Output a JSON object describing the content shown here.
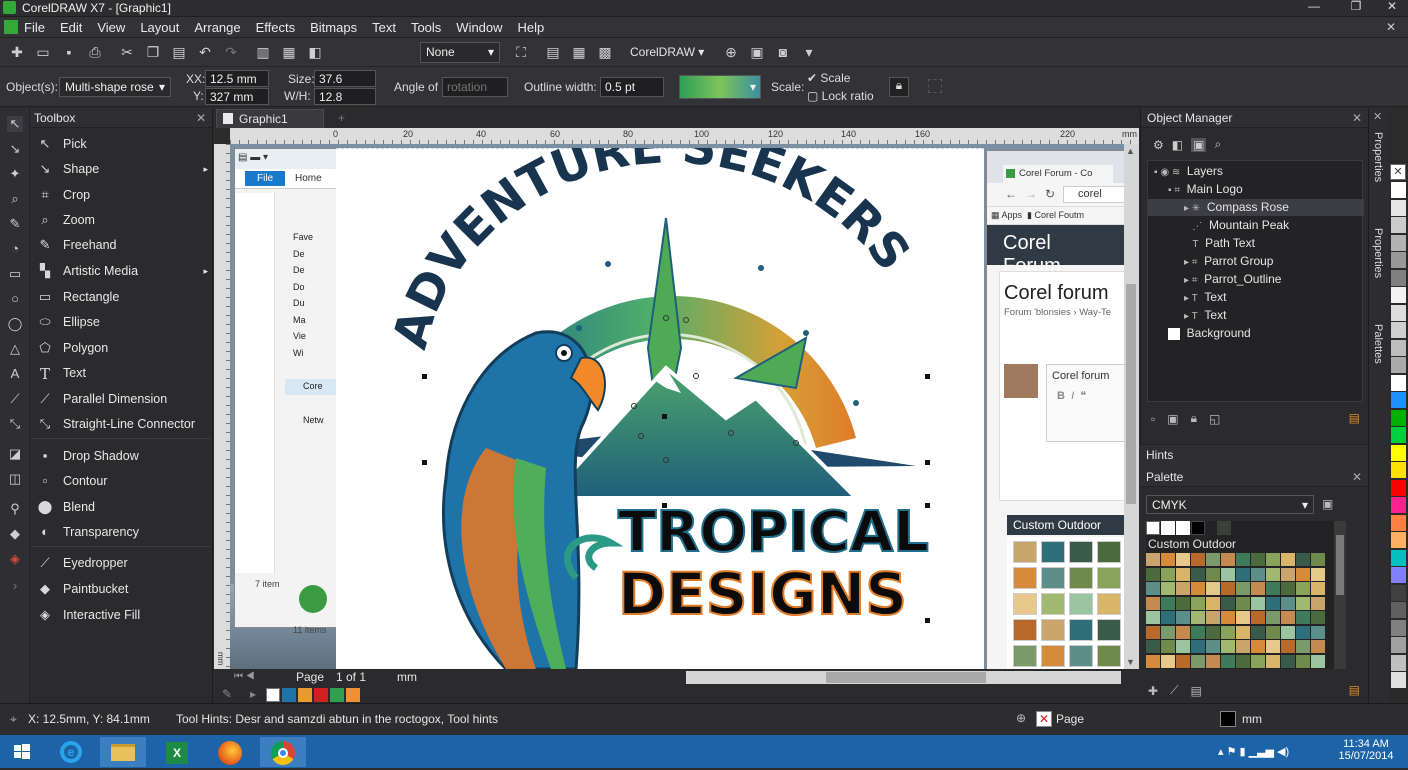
{
  "window": {
    "title": "CorelDRAW X7 - [Graphic1]"
  },
  "menu": [
    "File",
    "Edit",
    "View",
    "Layout",
    "Arrange",
    "Effects",
    "Bitmaps",
    "Text",
    "Tools",
    "Window",
    "Help"
  ],
  "toolbar": {
    "snap": "None",
    "launcher": "CorelDRAW"
  },
  "property_bar": {
    "objects_label": "Object(s):",
    "objects_value": "Multi-shape rose",
    "x_label": "XX:",
    "x_value": "12.5 mm",
    "y_label": "Y:",
    "y_value": "327 mm",
    "size_label": "Size:",
    "size_value": "37.6",
    "wh_label": "W/H:",
    "wh_value": "12.8",
    "angle_label": "Angle of",
    "angle_placeholder": "rotation",
    "outline_label": "Outline width:",
    "outline_value": "0.5 pt",
    "scale_label": "Scale:",
    "scale_check": "Scale",
    "lock_ratio": "Lock ratio"
  },
  "toolbox": {
    "title": "Toolbox",
    "tools": [
      "Pick",
      "Shape",
      "Crop",
      "Zoom",
      "Freehand",
      "Artistic Media",
      "Rectangle",
      "Ellipse",
      "Polygon",
      "Text",
      "Parallel Dimension",
      "Straight-Line Connector",
      "Drop Shadow",
      "Contour",
      "Blend",
      "Transparency",
      "Eyedropper",
      "Paintbucket",
      "Interactive Fill"
    ]
  },
  "document": {
    "tab": "Graphic1",
    "ruler_h": [
      "0",
      "20",
      "40",
      "60",
      "80",
      "100",
      "120",
      "140",
      "160",
      "220"
    ],
    "ruler_unit": "mm",
    "page_label": "Page",
    "page_count": "1 of 1",
    "units": "mm"
  },
  "explorer": {
    "file_tab": "File",
    "home_tab": "Home",
    "items": [
      "Fave",
      "De",
      "De",
      "Do",
      "Du",
      "Ma",
      "Vie",
      "Wi"
    ],
    "core": "Core",
    "network": "Netw",
    "count_a": "7 item",
    "count_b": "11 items"
  },
  "browser": {
    "tab": "Corel Forum - Co",
    "url": "corel",
    "apps": "Apps",
    "bookmark": "Corel Foutm",
    "site_title": "Corel Forum",
    "heading": "Corel forum",
    "breadcrumb": "Forum 'blonsies › Way-Te",
    "reply_placeholder": "Corel forum",
    "bold": "B",
    "italic": "I",
    "quote": "❝",
    "custom_outdoor": "Custom Outdoor"
  },
  "artwork": {
    "arc_text": "ADVENTURE SEEKERS",
    "line1": "TROPICAL",
    "line2": "DESIGNS"
  },
  "object_manager": {
    "title": "Object Manager",
    "nodes": [
      {
        "label": "Layers",
        "level": 0
      },
      {
        "label": "Main Logo",
        "level": 1
      },
      {
        "label": "Compass Rose",
        "level": 2
      },
      {
        "label": "Mountain Peak",
        "level": 2
      },
      {
        "label": "Path Text",
        "level": 2
      },
      {
        "label": "Parrot Group",
        "level": 2
      },
      {
        "label": "Parrot_Outline",
        "level": 2
      },
      {
        "label": "Text",
        "level": 2
      },
      {
        "label": "Text",
        "level": 2
      },
      {
        "label": "Background",
        "level": 1
      }
    ]
  },
  "hints": {
    "title": "Hints"
  },
  "palette": {
    "title": "Palette",
    "model": "CMYK",
    "group": "Custom Outdoor"
  },
  "side_tabs": [
    "Properties",
    "Properties",
    "Palettes"
  ],
  "status": {
    "coords": "X: 12.5mm, Y: 84.1mm",
    "hint": "Tool Hints: Desr and samzdi abtun in the roctogox, Tool hints",
    "page": "Page",
    "unit": "mm"
  },
  "clock": {
    "time": "11:34 AM",
    "date": "15/07/2014"
  },
  "colors": {
    "accent": "#3aa03a",
    "taskbar": "#1d63a8",
    "selection": "#3d3d44"
  }
}
